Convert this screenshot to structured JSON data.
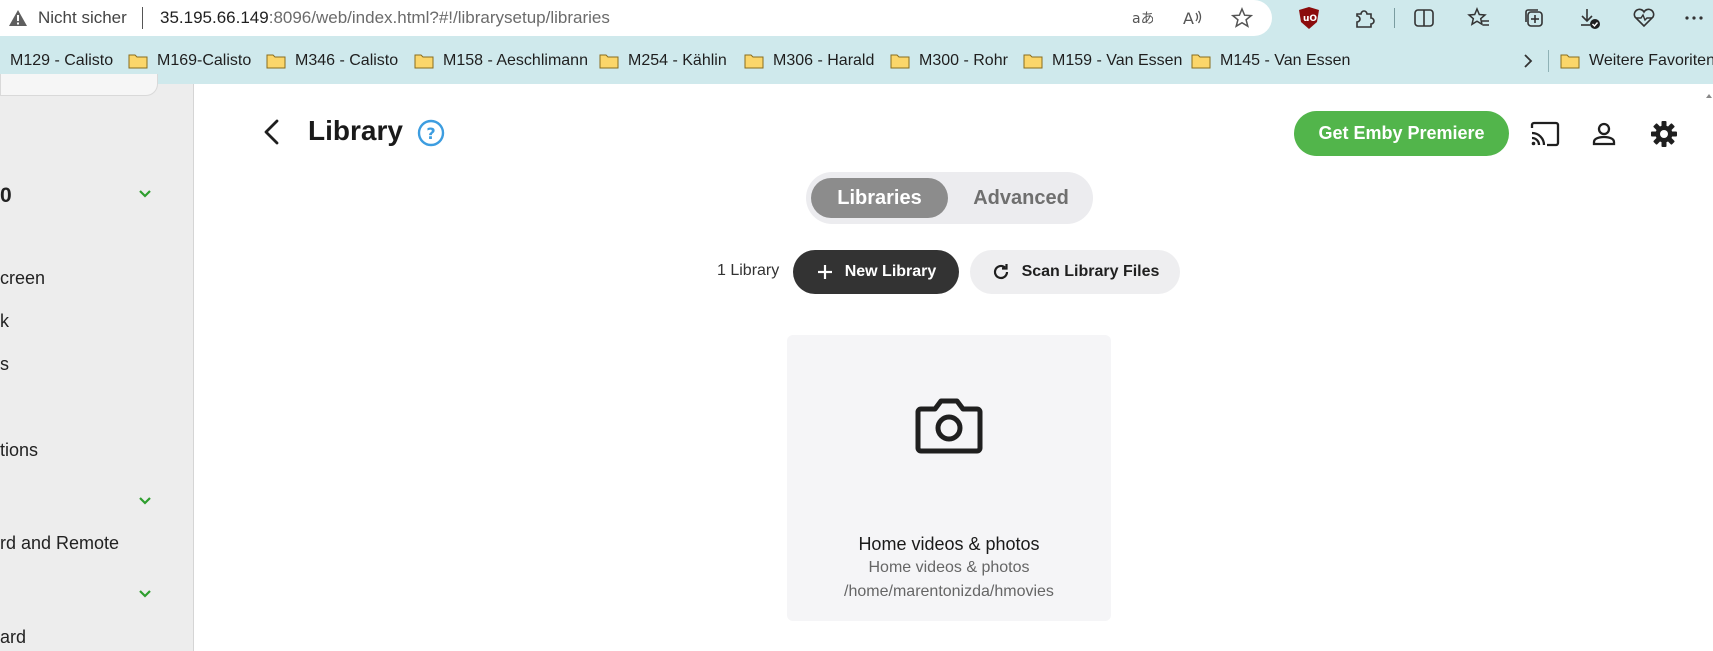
{
  "browser": {
    "security_label": "Nicht sicher",
    "url_host": "35.195.66.149",
    "url_rest": ":8096/web/index.html?#!/librarysetup/libraries",
    "address_icons": [
      "read-aloud-icon",
      "text-size-icon",
      "favorite-star-icon"
    ],
    "toolbar_icons": [
      "ublock-icon",
      "extensions-icon",
      "split-screen-icon",
      "favorites-icon",
      "collections-icon",
      "downloads-icon",
      "browser-essentials-icon",
      "more-menu-icon"
    ]
  },
  "favorites": [
    {
      "label": "M129 - Calisto",
      "folder": false
    },
    {
      "label": "M169-Calisto",
      "folder": true
    },
    {
      "label": "M346 - Calisto",
      "folder": true
    },
    {
      "label": "M158 - Aeschlimann",
      "folder": true
    },
    {
      "label": "M254 - Kählin",
      "folder": true
    },
    {
      "label": "M306 - Harald",
      "folder": true
    },
    {
      "label": "M300 - Rohr",
      "folder": true
    },
    {
      "label": "M159 - Van Essen",
      "folder": true
    },
    {
      "label": "M145 - Van Essen",
      "folder": true
    }
  ],
  "favorites_more": "Weitere Favoriten",
  "sidebar": {
    "heading": "0",
    "items": [
      "creen",
      "k",
      "s",
      "tions",
      "rd and Remote",
      "ard"
    ]
  },
  "header": {
    "title": "Library",
    "premiere_label": "Get Emby Premiere"
  },
  "tabs": [
    {
      "label": "Libraries",
      "active": true
    },
    {
      "label": "Advanced",
      "active": false
    }
  ],
  "toolbar": {
    "library_count": "1 Library",
    "new_library_label": "New Library",
    "scan_label": "Scan Library Files"
  },
  "libraries": [
    {
      "name": "Home videos & photos",
      "type": "Home videos & photos",
      "path": "/home/marentonizda/hmovies",
      "icon": "camera-icon"
    }
  ],
  "colors": {
    "accent_green": "#52b54b",
    "chevron_green": "#2e9e2e",
    "browser_chrome": "#cfe9ec",
    "dark_button": "#333333"
  }
}
